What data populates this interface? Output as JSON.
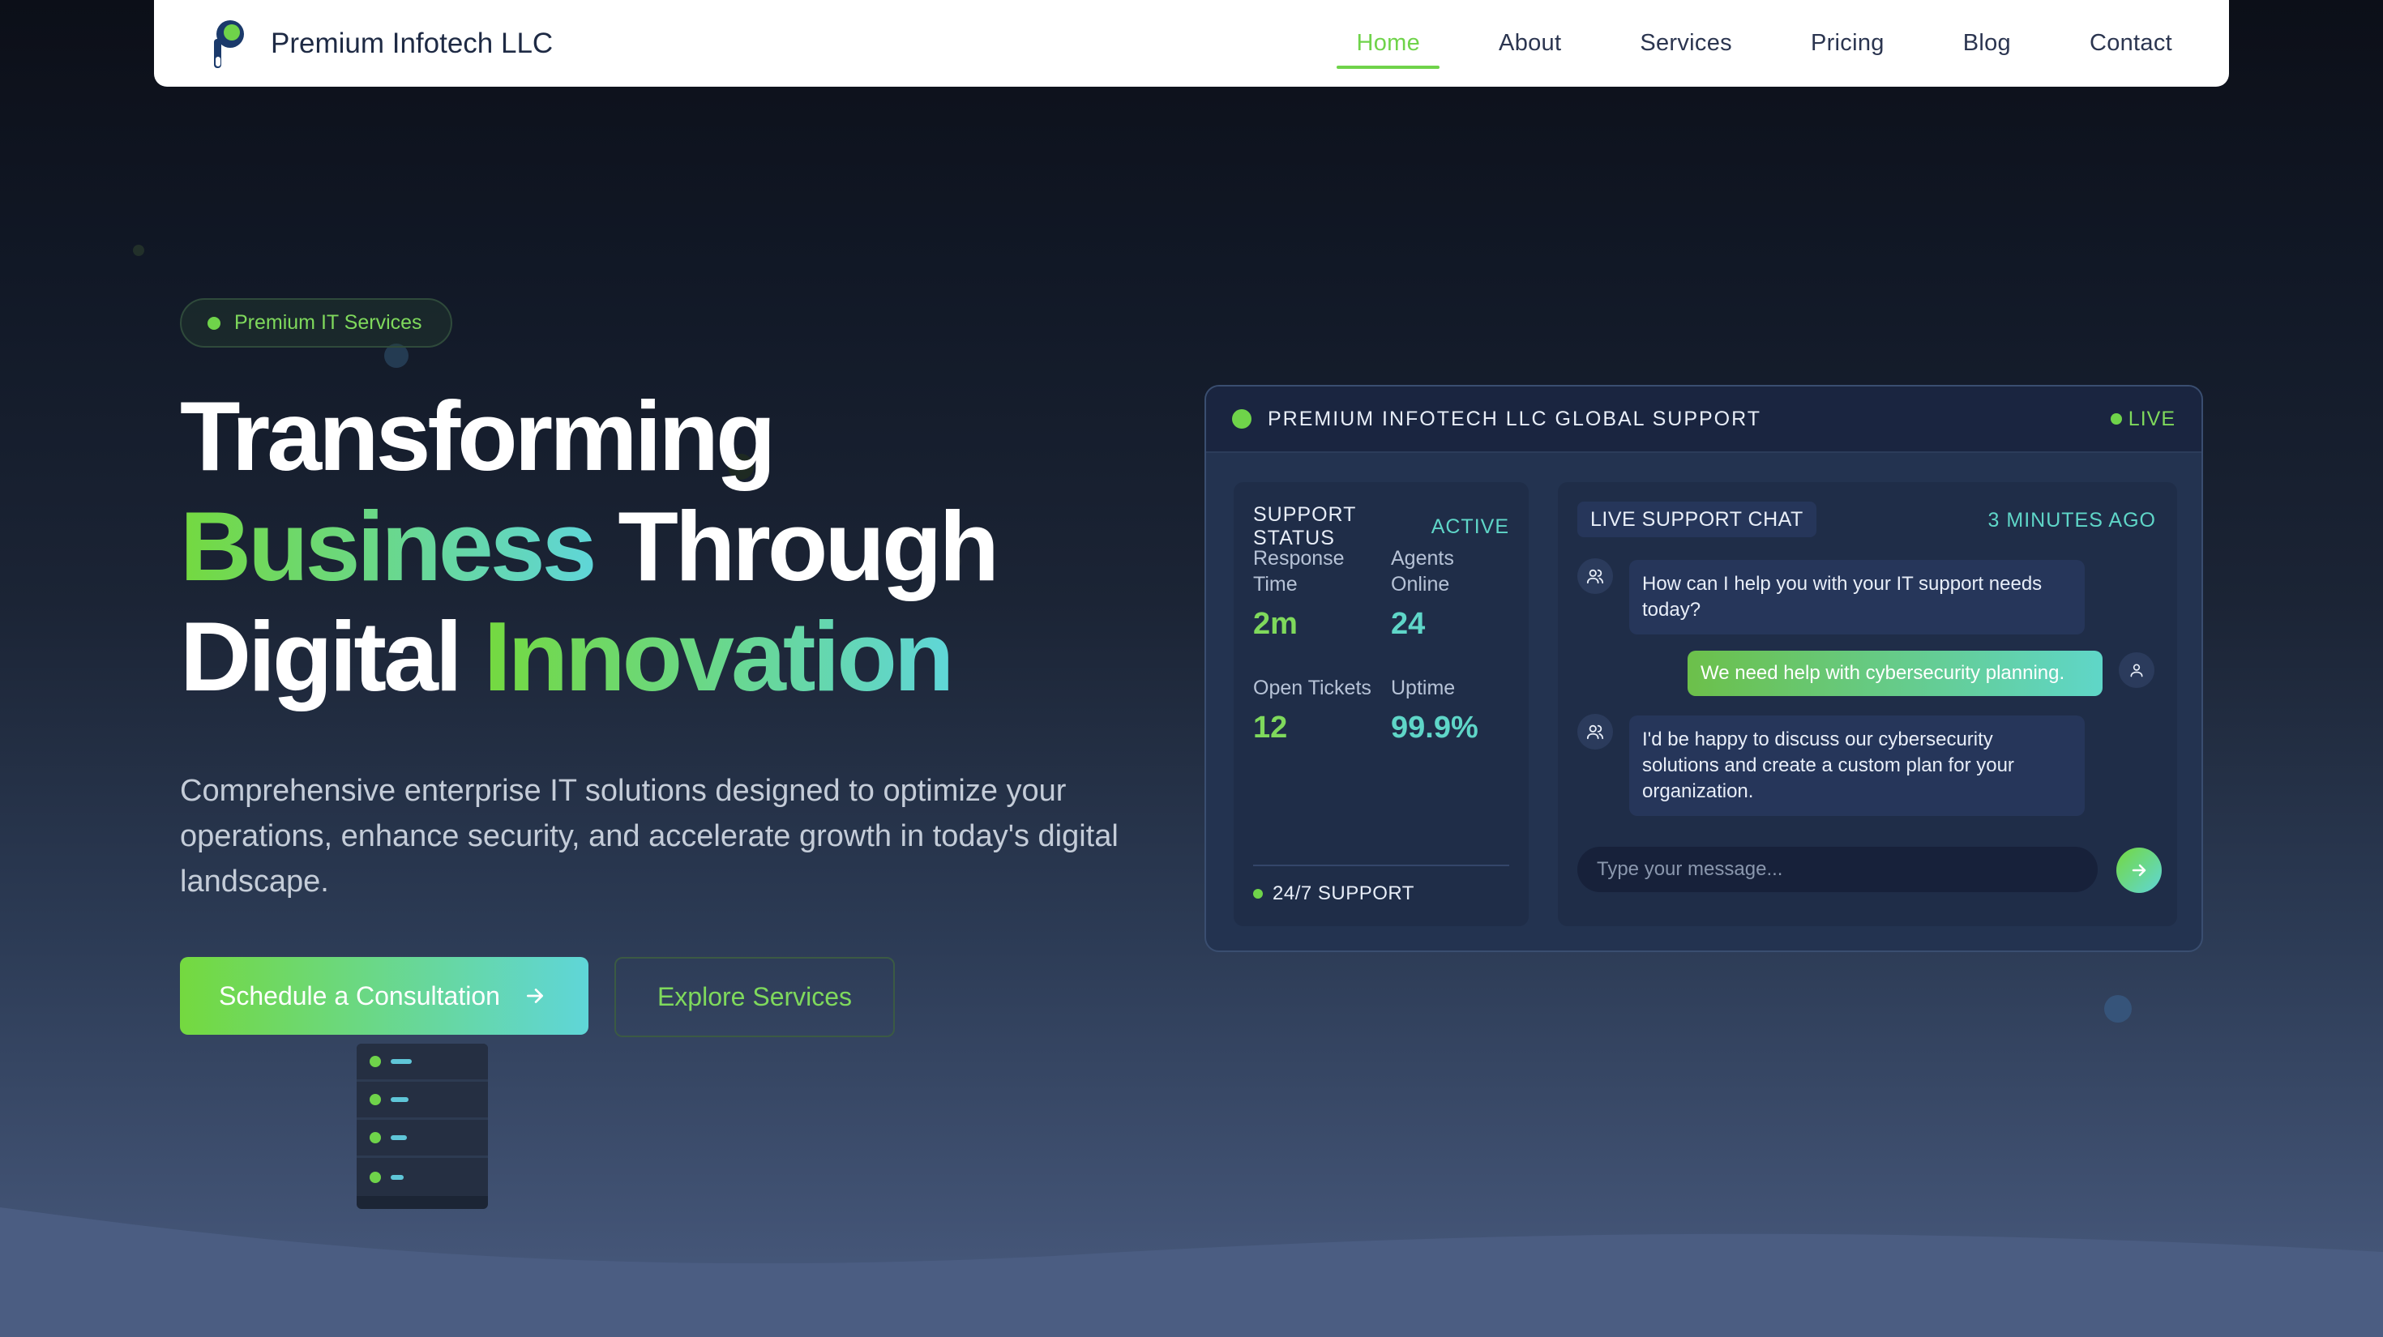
{
  "nav": {
    "brand": "Premium Infotech LLC",
    "items": [
      {
        "label": "Home",
        "active": true
      },
      {
        "label": "About"
      },
      {
        "label": "Services"
      },
      {
        "label": "Pricing"
      },
      {
        "label": "Blog"
      },
      {
        "label": "Contact"
      }
    ]
  },
  "hero": {
    "badge": "Premium IT Services",
    "headline": {
      "l1": "Transforming",
      "l2a": "Business",
      "l2b": "Through",
      "l3a": "Digital",
      "l3b": "Innovation"
    },
    "subtitle": "Comprehensive enterprise IT solutions designed to optimize your operations, enhance security, and accelerate growth in today's digital landscape.",
    "primary_cta": "Schedule a Consultation",
    "secondary_cta": "Explore Services"
  },
  "dashboard": {
    "title": "PREMIUM INFOTECH LLC GLOBAL SUPPORT",
    "live_label": "LIVE",
    "status": {
      "heading": "SUPPORT STATUS",
      "state": "ACTIVE",
      "stats": [
        {
          "label": "Response Time",
          "value": "2m"
        },
        {
          "label": "Agents Online",
          "value": "24"
        },
        {
          "label": "Open Tickets",
          "value": "12"
        },
        {
          "label": "Uptime",
          "value": "99.9%"
        }
      ],
      "footer": "24/7 SUPPORT"
    },
    "chat": {
      "heading": "LIVE SUPPORT CHAT",
      "time": "3 MINUTES AGO",
      "messages": [
        {
          "from": "agent",
          "text": "How can I help you with your IT support needs today?"
        },
        {
          "from": "user",
          "text": "We need help with cybersecurity planning."
        },
        {
          "from": "agent",
          "text": "I'd be happy to discuss our cybersecurity solutions and create a custom plan for your organization."
        }
      ],
      "input_placeholder": "Type your message..."
    }
  },
  "colors": {
    "accent_green": "#6fd34a",
    "accent_teal": "#5fd6d8",
    "nav_bg": "#ffffff"
  },
  "icons": {
    "logo": "headset-logo-icon",
    "cta_arrow": "arrow-right-icon",
    "agent": "users-icon",
    "user": "user-icon",
    "send": "send-arrow-icon"
  }
}
